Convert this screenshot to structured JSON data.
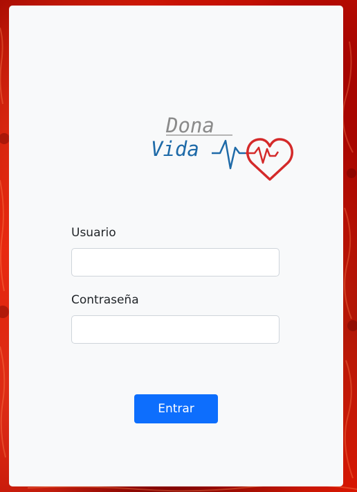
{
  "logo": {
    "line1": "Dona",
    "line2": "Vida",
    "colors": {
      "line1": "#8a8a8a",
      "line2": "#1e6aa8",
      "heart": "#d42a2a"
    }
  },
  "form": {
    "username_label": "Usuario",
    "username_value": "",
    "password_label": "Contraseña",
    "password_value": "",
    "submit_label": "Entrar"
  },
  "theme": {
    "accent": "#0d6efd",
    "card_bg": "#f8f9fa",
    "background": "#c40d00"
  }
}
